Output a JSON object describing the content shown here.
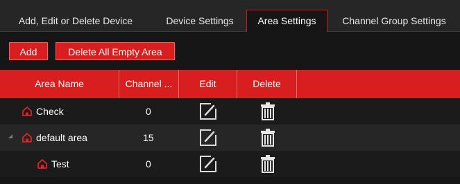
{
  "tabs": [
    {
      "label": "Add, Edit or Delete Device"
    },
    {
      "label": "Device Settings"
    },
    {
      "label": "Area Settings"
    },
    {
      "label": "Channel Group Settings"
    }
  ],
  "toolbar": {
    "add_label": "Add",
    "delete_all_label": "Delete All Empty Area"
  },
  "table": {
    "columns": [
      "Area Name",
      "Channel ...",
      "Edit",
      "Delete"
    ],
    "rows": [
      {
        "name": "Check",
        "channels": "0"
      },
      {
        "name": "default area",
        "channels": "15"
      },
      {
        "name": "Test",
        "channels": "0"
      }
    ]
  },
  "colors": {
    "accent": "#d81e1e",
    "home_icon": "#e02424",
    "background": "#161616"
  },
  "icons": {
    "area": "home-icon",
    "edit": "edit-icon",
    "delete": "trash-icon",
    "expander": "expand-arrow-icon"
  }
}
